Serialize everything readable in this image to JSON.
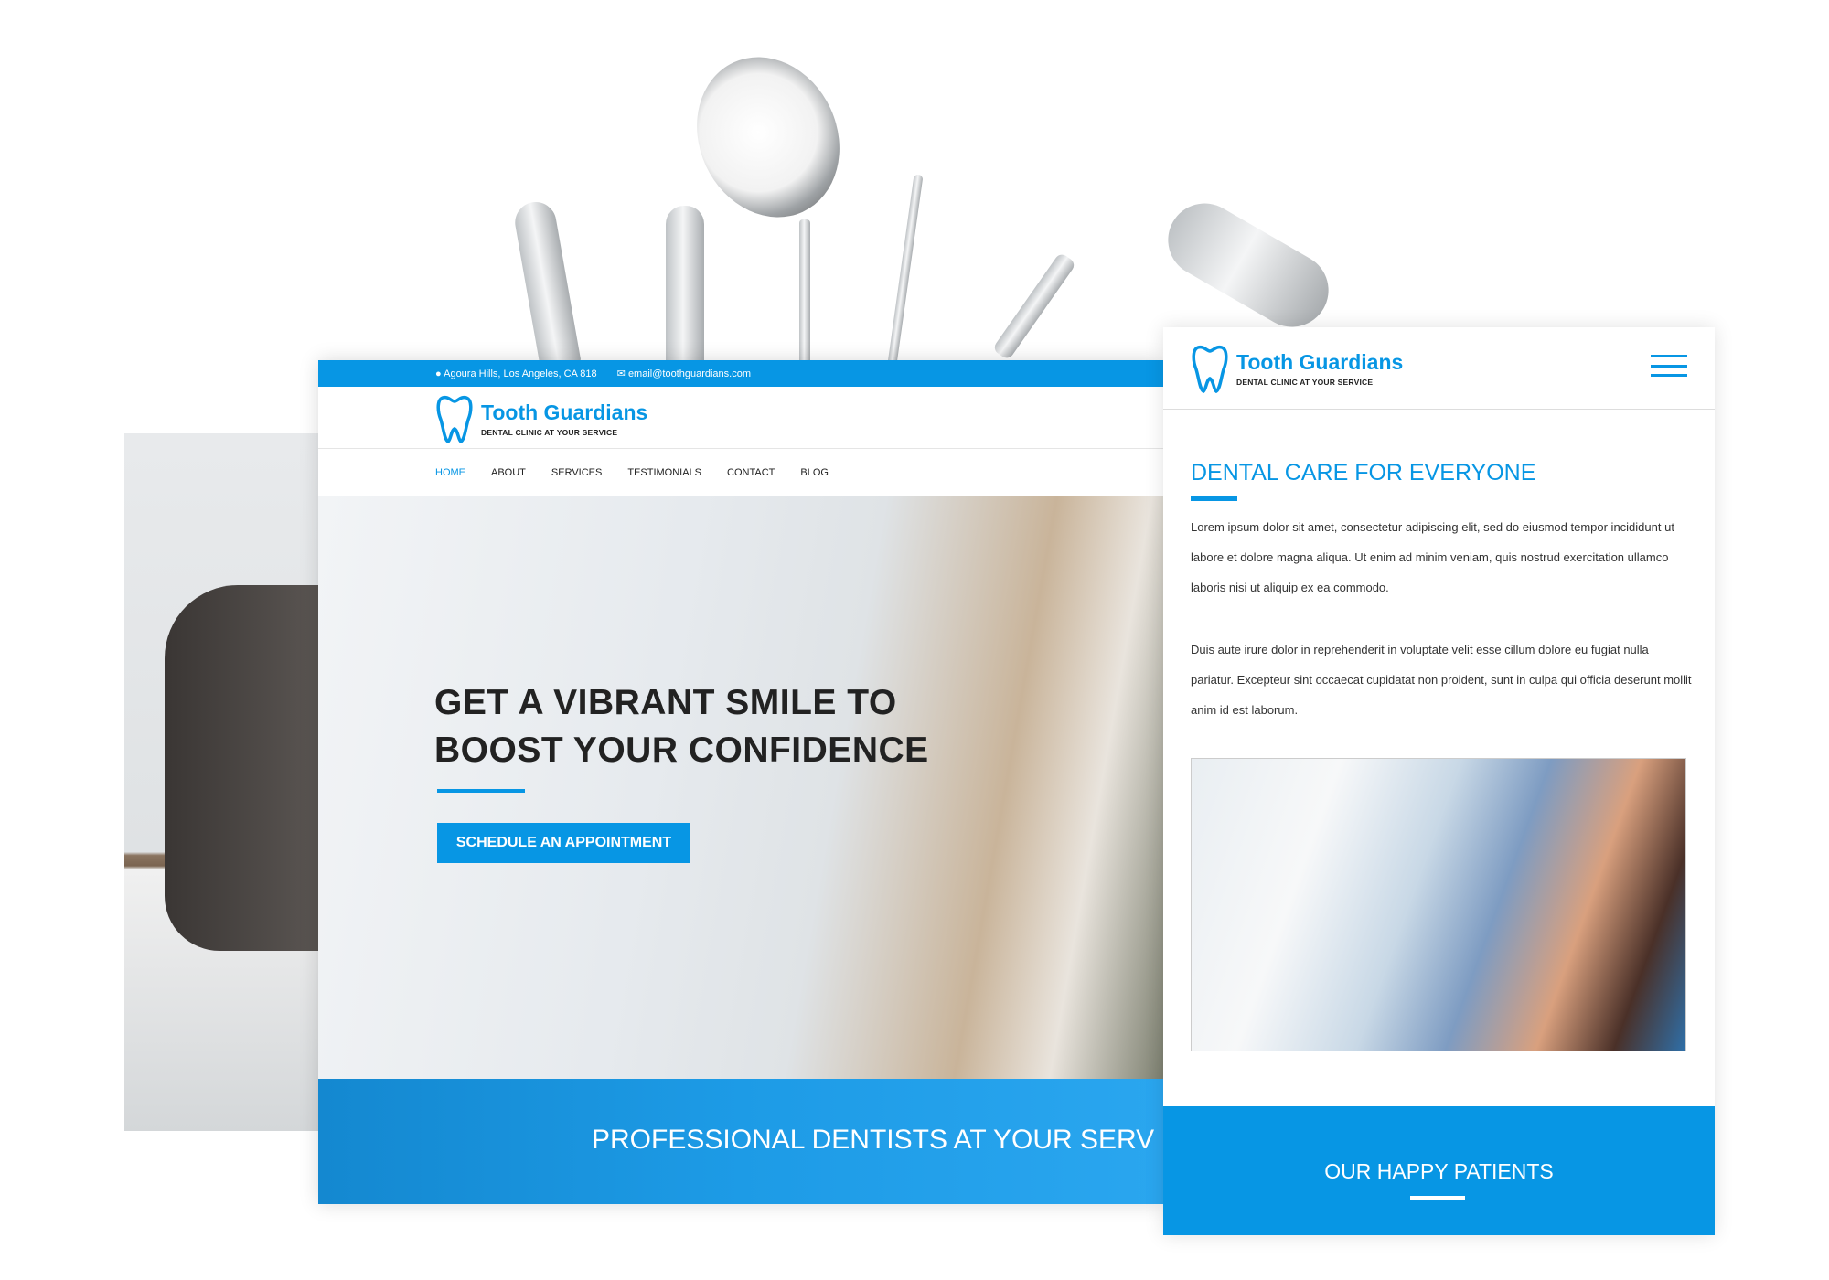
{
  "desktop": {
    "topbar": {
      "address": "Agoura Hills, Los Angeles, CA 818",
      "email": "email@toothguardians.com",
      "location_icon": "map-pin-icon",
      "email_icon": "envelope-icon"
    },
    "logo": {
      "name": "Tooth Guardians",
      "tagline": "DENTAL CLINIC AT YOUR SERVICE"
    },
    "nav": [
      {
        "label": "HOME",
        "active": true
      },
      {
        "label": "ABOUT"
      },
      {
        "label": "SERVICES"
      },
      {
        "label": "TESTIMONIALS"
      },
      {
        "label": "CONTACT"
      },
      {
        "label": "BLOG"
      }
    ],
    "hero": {
      "title_line1": "GET A VIBRANT SMILE TO",
      "title_line2": "BOOST YOUR CONFIDENCE",
      "button": "SCHEDULE AN APPOINTMENT"
    },
    "band": {
      "text": "PROFESSIONAL DENTISTS AT YOUR SERV"
    }
  },
  "mobile": {
    "logo": {
      "name": "Tooth Guardians",
      "tagline": "DENTAL CLINIC AT YOUR SERVICE"
    },
    "menu_icon": "hamburger-icon",
    "section_title": "DENTAL CARE FOR EVERYONE",
    "paragraph1": "Lorem ipsum dolor sit amet, consectetur adipiscing elit, sed do eiusmod tempor incididunt ut labore et dolore magna aliqua. Ut enim ad minim veniam, quis nostrud exercitation ullamco laboris nisi ut aliquip ex ea commodo.",
    "paragraph2": "Duis aute irure dolor in reprehenderit in voluptate velit esse cillum dolore eu fugiat nulla pariatur. Excepteur sint occaecat cupidatat non proident, sunt in culpa qui officia deserunt mollit anim id est laborum.",
    "band_title": "OUR HAPPY PATIENTS"
  },
  "colors": {
    "accent": "#0796e4",
    "text": "#222222"
  }
}
